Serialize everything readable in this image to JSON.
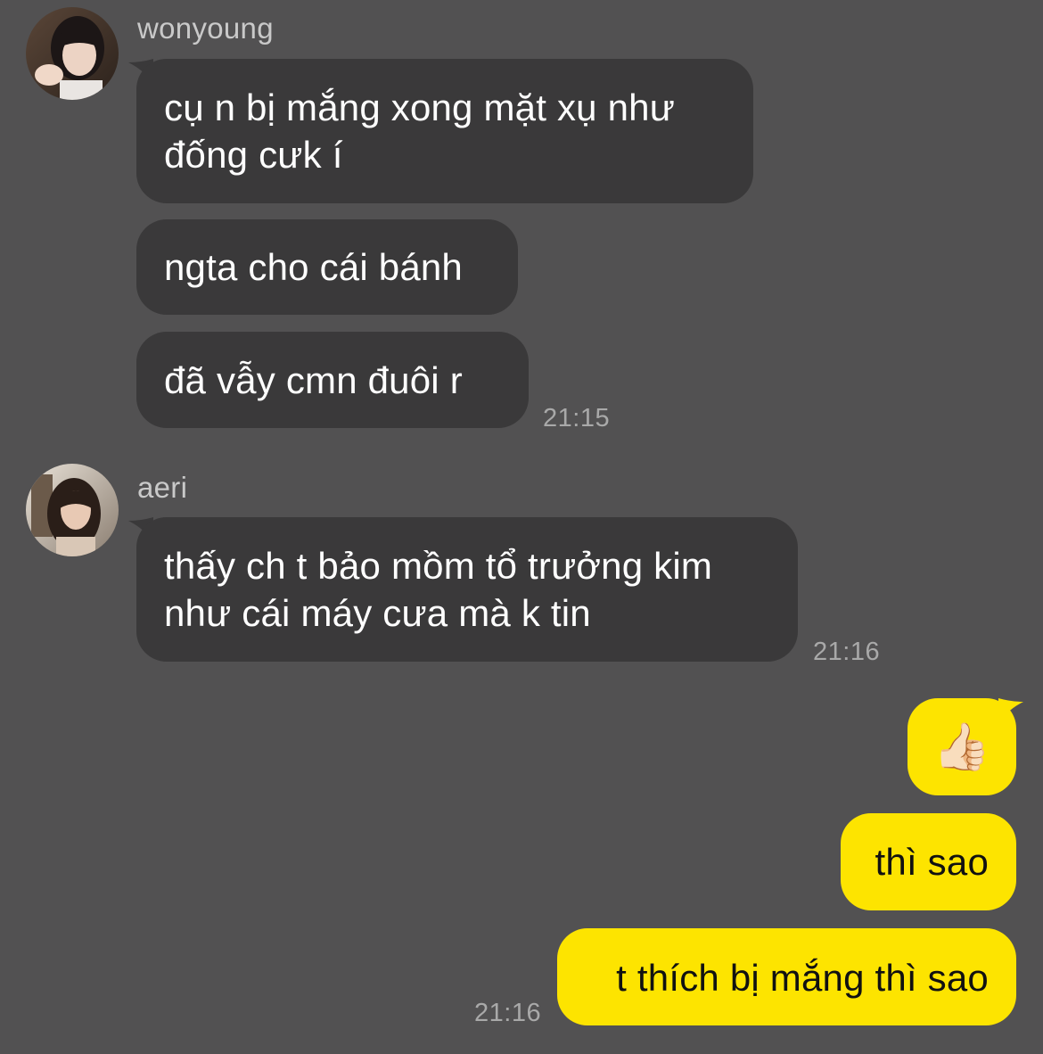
{
  "colors": {
    "background": "#525152",
    "incoming_bubble": "#3a393a",
    "outgoing_bubble": "#fde400",
    "sender_name": "#c9c9c9",
    "timestamp": "#a9a9a9"
  },
  "groups": [
    {
      "sender": "wonyoung",
      "avatar_icon": "profile-photo-icon",
      "messages": [
        "cụ n bị mắng xong mặt xụ như\nđống cưk í",
        "ngta cho cái bánh",
        "đã vẫy cmn đuôi r"
      ],
      "time": "21:15"
    },
    {
      "sender": "aeri",
      "avatar_icon": "profile-photo-icon",
      "messages": [
        "thấy ch t bảo mồm tổ trưởng kim\nnhư cái máy cưa mà k tin"
      ],
      "time": "21:16"
    }
  ],
  "outgoing": {
    "emoji": "👍🏻",
    "emoji_icon": "thumbs-up-icon",
    "messages": [
      "thì sao",
      "t thích bị mắng thì sao"
    ],
    "time": "21:16"
  }
}
